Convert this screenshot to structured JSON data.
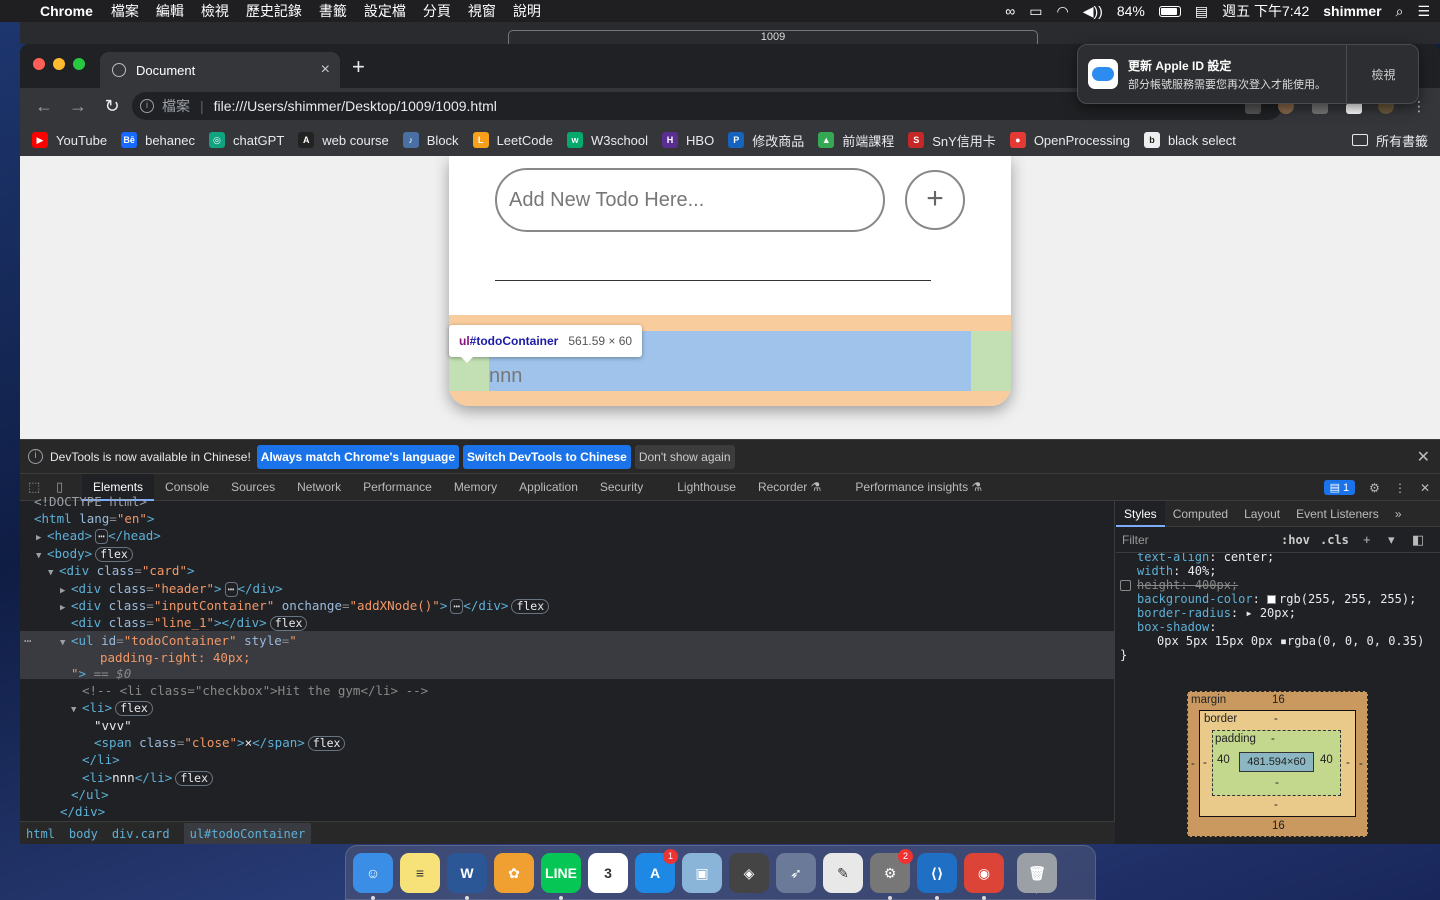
{
  "menubar": {
    "app_name": "Chrome",
    "items": [
      "檔案",
      "編輯",
      "檢視",
      "歷史記錄",
      "書籤",
      "設定檔",
      "分頁",
      "視窗",
      "說明"
    ],
    "battery": "84%",
    "clock": "週五 下午7:42",
    "user": "shimmer"
  },
  "behind_window": {
    "address": "1009"
  },
  "browser": {
    "tab_title": "Document",
    "omnibox": {
      "scheme": "檔案",
      "url": "file:///Users/shimmer/Desktop/1009/1009.html"
    },
    "bookmarks": [
      {
        "label": "YouTube",
        "color": "#ff0000",
        "glyph": "▶"
      },
      {
        "label": "behanec",
        "color": "#1769ff",
        "glyph": "Bē"
      },
      {
        "label": "chatGPT",
        "color": "#10a37f",
        "glyph": "◎"
      },
      {
        "label": "web course",
        "color": "#222222",
        "glyph": "A"
      },
      {
        "label": "Block",
        "color": "#4a6fa5",
        "glyph": "♪"
      },
      {
        "label": "LeetCode",
        "color": "#f89f1b",
        "glyph": "L"
      },
      {
        "label": "W3school",
        "color": "#04aa6d",
        "glyph": "w"
      },
      {
        "label": "HBO",
        "color": "#5a2d91",
        "glyph": "H"
      },
      {
        "label": "修改商品",
        "color": "#1565c0",
        "glyph": "P"
      },
      {
        "label": "前端課程",
        "color": "#34a853",
        "glyph": "▲"
      },
      {
        "label": "SnY信用卡",
        "color": "#c62828",
        "glyph": "S"
      },
      {
        "label": "OpenProcessing",
        "color": "#e53935",
        "glyph": "●"
      },
      {
        "label": "black select",
        "color": "#eeeeee",
        "glyph": "b"
      }
    ],
    "bookmarks_more": "»",
    "all_bookmarks": "所有書籤"
  },
  "notification": {
    "title": "更新 Apple ID 設定",
    "body": "部分帳號服務需要您再次登入才能使用。",
    "action": "檢視"
  },
  "page": {
    "input_placeholder": "Add New Todo Here...",
    "add_button": "+",
    "todos": [
      "vvvx",
      "nnn"
    ],
    "tooltip": {
      "selector_tag": "ul",
      "selector_id": "#todoContainer",
      "size": "561.59 × 60"
    }
  },
  "devtools": {
    "banner": {
      "message": "DevTools is now available in Chinese!",
      "btn_match": "Always match Chrome's language",
      "btn_switch": "Switch DevTools to Chinese",
      "btn_dismiss": "Don't show again"
    },
    "tabs": [
      "Elements",
      "Console",
      "Sources",
      "Network",
      "Performance",
      "Memory",
      "Application",
      "Security",
      "Lighthouse",
      "Recorder ⚗",
      "Performance insights ⚗"
    ],
    "issues_count": "1",
    "breadcrumbs": [
      "html",
      "body",
      "div.card",
      "ul#todoContainer"
    ],
    "styles": {
      "tabs": [
        "Styles",
        "Computed",
        "Layout",
        "Event Listeners"
      ],
      "filter_placeholder": "Filter",
      "hov": ":hov",
      "cls": ".cls",
      "rules": [
        {
          "prop": "text-align",
          "value": "center;",
          "struck": false
        },
        {
          "prop": "width",
          "value": "40%;",
          "struck": false
        },
        {
          "prop": "height",
          "value": "400px;",
          "struck": true
        },
        {
          "prop": "background-color",
          "value": "rgb(255, 255, 255);",
          "struck": false,
          "swatch": "#ffffff"
        },
        {
          "prop": "border-radius",
          "value": "▸ 20px;",
          "struck": false
        },
        {
          "prop": "box-shadow",
          "value": "",
          "struck": false
        },
        {
          "prop": "",
          "value": "0px 5px 15px 0px ▪rgba(0, 0, 0, 0.35)",
          "struck": false
        }
      ],
      "box_model": {
        "margin_label": "margin",
        "margin_top": "16",
        "margin_bottom": "16",
        "margin_left": "-",
        "margin_right": "-",
        "border_label": "border",
        "border_top": "-",
        "border_bottom": "-",
        "border_left": "-",
        "border_right": "-",
        "padding_label": "padding",
        "padding_top": "-",
        "padding_bottom": "-",
        "padding_left": "40",
        "padding_right": "40",
        "content": "481.594×60"
      }
    }
  },
  "dock": {
    "apps": [
      {
        "name": "Finder",
        "color": "#3a8ee6",
        "glyph": "☺",
        "running": true,
        "badge": ""
      },
      {
        "name": "Notes",
        "color": "#f7e27a",
        "glyph": "≡",
        "running": false,
        "badge": ""
      },
      {
        "name": "Word",
        "color": "#2b5797",
        "glyph": "W",
        "running": true,
        "badge": ""
      },
      {
        "name": "Photos",
        "color": "#f0a030",
        "glyph": "✿",
        "running": false,
        "badge": ""
      },
      {
        "name": "LINE",
        "color": "#06c755",
        "glyph": "LINE",
        "running": true,
        "badge": ""
      },
      {
        "name": "Calendar",
        "color": "#ffffff",
        "glyph": "3",
        "running": false,
        "badge": ""
      },
      {
        "name": "App Store",
        "color": "#1e88e5",
        "glyph": "A",
        "running": false,
        "badge": "1"
      },
      {
        "name": "Preview",
        "color": "#8ab4d8",
        "glyph": "▣",
        "running": false,
        "badge": ""
      },
      {
        "name": "Unity",
        "color": "#444444",
        "glyph": "◈",
        "running": false,
        "badge": ""
      },
      {
        "name": "Launchpad",
        "color": "#6b7a99",
        "glyph": "➶",
        "running": false,
        "badge": ""
      },
      {
        "name": "TextEdit",
        "color": "#e8e8e8",
        "glyph": "✎",
        "running": false,
        "badge": ""
      },
      {
        "name": "System Preferences",
        "color": "#777777",
        "glyph": "⚙",
        "running": true,
        "badge": "2"
      },
      {
        "name": "VS Code",
        "color": "#1f6fc5",
        "glyph": "⟨⟩",
        "running": true,
        "badge": ""
      },
      {
        "name": "Chrome",
        "color": "#db4437",
        "glyph": "◉",
        "running": true,
        "badge": ""
      },
      {
        "name": "Trash",
        "color": "#9aa0a6",
        "glyph": "🗑",
        "running": false,
        "badge": ""
      }
    ]
  }
}
